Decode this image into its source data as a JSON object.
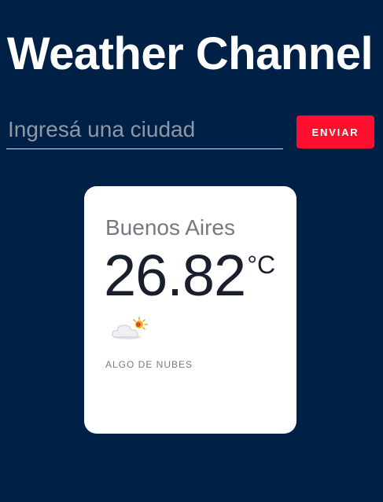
{
  "header": {
    "title": "Weather Channel"
  },
  "search": {
    "placeholder": "Ingresá una ciudad",
    "value": "",
    "button_label": "ENVIAR"
  },
  "weather": {
    "city": "Buenos Aires",
    "temperature": "26.82",
    "unit": "°C",
    "icon": "partly-cloudy-icon",
    "description": "ALGO DE NUBES"
  },
  "colors": {
    "background": "#012046",
    "accent": "#ff0f2d",
    "card": "#ffffff"
  }
}
